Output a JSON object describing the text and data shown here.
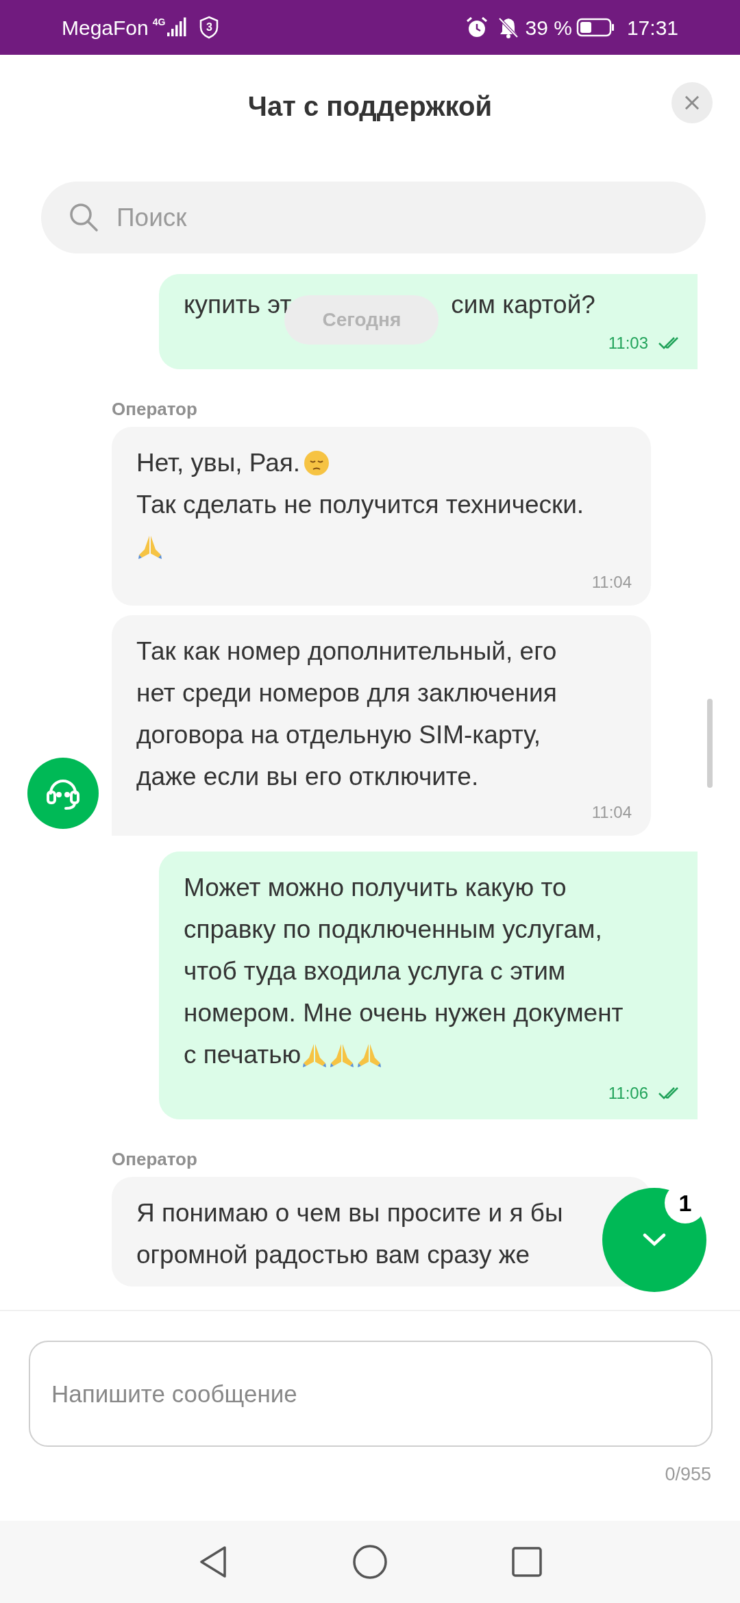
{
  "status_bar": {
    "carrier": "MegaFon",
    "network": "4G",
    "sim_badge": "3",
    "battery": "39 %",
    "time": "17:31"
  },
  "header": {
    "title": "Чат с поддержкой"
  },
  "search": {
    "placeholder": "Поиск"
  },
  "messages": [
    {
      "kind": "user_message",
      "lines": [
        {
          "text": "купить эт",
          "after_pill": "сим картой?"
        }
      ],
      "date_pill": "Сегодня",
      "time": "11:03",
      "read": true
    },
    {
      "kind": "operator_label",
      "name": "Оператор"
    },
    {
      "kind": "operator_message",
      "avatar": false,
      "lines": [
        {
          "text": "Нет, увы, Рая.",
          "emoji": [
            {
              "kind": "pensive"
            }
          ]
        },
        {
          "text": "Так сделать не получится технически."
        },
        {
          "emoji": [
            {
              "kind": "pray"
            }
          ]
        }
      ],
      "time": "11:04"
    },
    {
      "kind": "operator_message",
      "avatar": true,
      "lines": [
        {
          "text": "Так как номер дополнительный, его"
        },
        {
          "text": "нет среди номеров для заключения"
        },
        {
          "text": "договора на отдельную SIM-карту,"
        },
        {
          "text": "даже если вы его отключите."
        }
      ],
      "time": "11:04"
    },
    {
      "kind": "user_message",
      "lines": [
        {
          "text": "Может можно получить какую то"
        },
        {
          "text": "справку по подключенным услугам,"
        },
        {
          "text": "чтоб туда входила услуга с этим"
        },
        {
          "text": "номером. Мне очень нужен документ"
        },
        {
          "text": "с печатью",
          "emoji": [
            {
              "kind": "pray"
            },
            {
              "kind": "pray"
            },
            {
              "kind": "pray"
            }
          ]
        }
      ],
      "time": "11:06",
      "read": true
    },
    {
      "kind": "operator_label",
      "name": "Оператор"
    },
    {
      "kind": "operator_message",
      "avatar": false,
      "lines": [
        {
          "text": "Я понимаю о чем вы просите и я бы"
        },
        {
          "text": "огромной радостью вам сразу же"
        }
      ]
    }
  ],
  "scroll_button": {
    "unread": "1"
  },
  "composer": {
    "placeholder": "Напишите сообщение",
    "counter": "0/955"
  }
}
